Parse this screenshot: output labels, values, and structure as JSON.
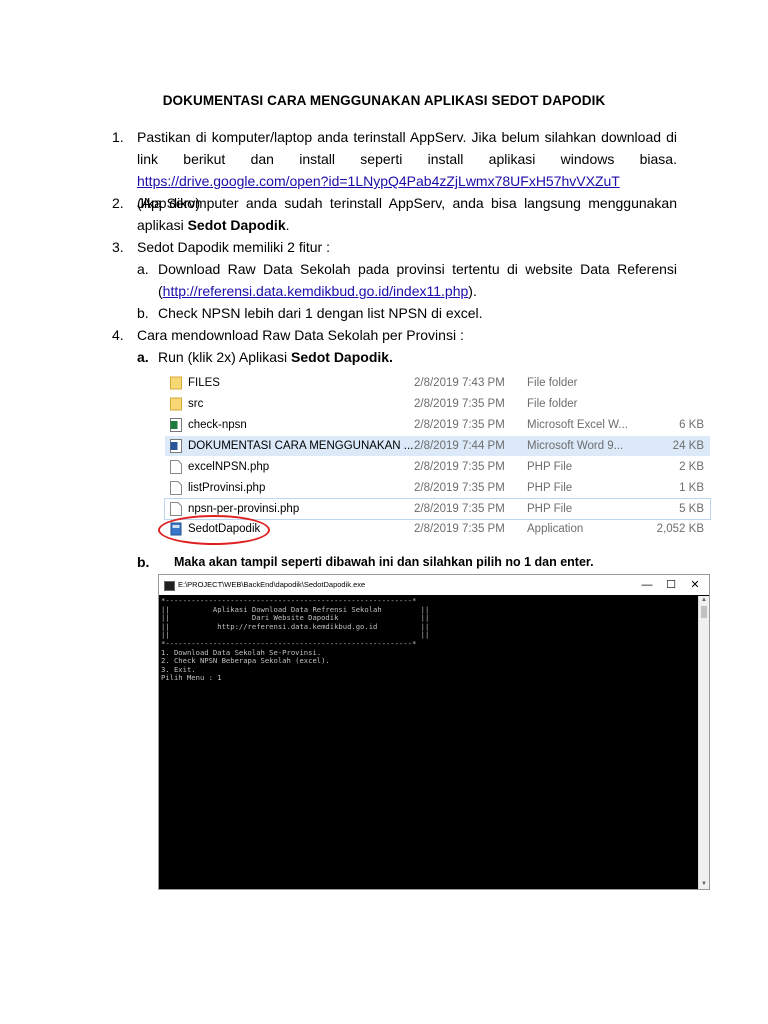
{
  "doc": {
    "title": "DOKUMENTASI CARA MENGGUNAKAN APLIKASI SEDOT DAPODIK",
    "step1": {
      "num": "1.",
      "line1": "Pastikan di komputer/laptop anda terinstall AppServ. Jika belum silahkan download di",
      "line2": "link berikut dan install seperti install aplikasi windows biasa.",
      "link": "https://drive.google.com/open?id=1LNypQ4Pab4zZjLwmx78UFxH57hvVXZuT",
      "after_link": " (AppServ)"
    },
    "step2": {
      "num": "2.",
      "line1": "Jika dikomputer anda sudah terinstall AppServ, anda bisa langsung menggunakan",
      "line2_pre": "aplikasi ",
      "line2_bold": "Sedot Dapodik",
      "line2_post": "."
    },
    "step3": {
      "num": "3.",
      "text": "Sedot Dapodik memiliki 2 fitur :",
      "a_label": "a.",
      "a_line1": "Download Raw Data Sekolah pada provinsi tertentu di website Data Referensi",
      "a_open": "(",
      "a_link": "http://referensi.data.kemdikbud.go.id/index11.php",
      "a_close": ").",
      "b_label": "b.",
      "b_text": "Check NPSN lebih dari 1 dengan list NPSN di excel."
    },
    "step4": {
      "num": "4.",
      "text": "Cara mendownload Raw Data Sekolah per Provinsi :",
      "a_label": "a.",
      "a_pre": "Run (klik 2x) Aplikasi ",
      "a_bold": "Sedot Dapodik.",
      "b_label": "b.",
      "b_text": "Maka akan tampil seperti dibawah ini dan silahkan pilih no 1 dan enter."
    }
  },
  "files": [
    {
      "name": "FILES",
      "date": "2/8/2019 7:43 PM",
      "type": "File folder",
      "size": "",
      "icon": "folder-icon"
    },
    {
      "name": "src",
      "date": "2/8/2019 7:35 PM",
      "type": "File folder",
      "size": "",
      "icon": "folder-icon"
    },
    {
      "name": "check-npsn",
      "date": "2/8/2019 7:35 PM",
      "type": "Microsoft Excel W...",
      "size": "6 KB",
      "icon": "excel-file-icon"
    },
    {
      "name": "DOKUMENTASI CARA MENGGUNAKAN ...",
      "date": "2/8/2019 7:44 PM",
      "type": "Microsoft Word 9...",
      "size": "24 KB",
      "icon": "word-file-icon"
    },
    {
      "name": "excelNPSN.php",
      "date": "2/8/2019 7:35 PM",
      "type": "PHP File",
      "size": "2 KB",
      "icon": "file-icon"
    },
    {
      "name": "listProvinsi.php",
      "date": "2/8/2019 7:35 PM",
      "type": "PHP File",
      "size": "1 KB",
      "icon": "file-icon"
    },
    {
      "name": "npsn-per-provinsi.php",
      "date": "2/8/2019 7:35 PM",
      "type": "PHP File",
      "size": "5 KB",
      "icon": "file-icon"
    },
    {
      "name": "SedotDapodik",
      "date": "2/8/2019 7:35 PM",
      "type": "Application",
      "size": "2,052 KB",
      "icon": "application-icon"
    }
  ],
  "console": {
    "title": "E:\\PROJECT\\WEB\\BackEnd\\dapodik\\SedotDapodik.exe",
    "minimize": "—",
    "maximize": "☐",
    "close": "✕",
    "lines": [
      "*---------------------------------------------------------*",
      "||          Aplikasi Download Data Refrensi Sekolah         ||",
      "||                   Dari Website Dapodik                   ||",
      "||           http://referensi.data.kemdikbud.go.id          ||",
      "||                                                          ||",
      "*---------------------------------------------------------*",
      "1. Download Data Sekolah Se-Provinsi.",
      "2. Check NPSN Beberapa Sekolah (excel).",
      "3. Exit.",
      "Pilih Menu : 1"
    ]
  },
  "colors": {
    "link": "#1a0dab",
    "highlight_ring": "#e02020",
    "selected_row": "#dbe9f8"
  }
}
